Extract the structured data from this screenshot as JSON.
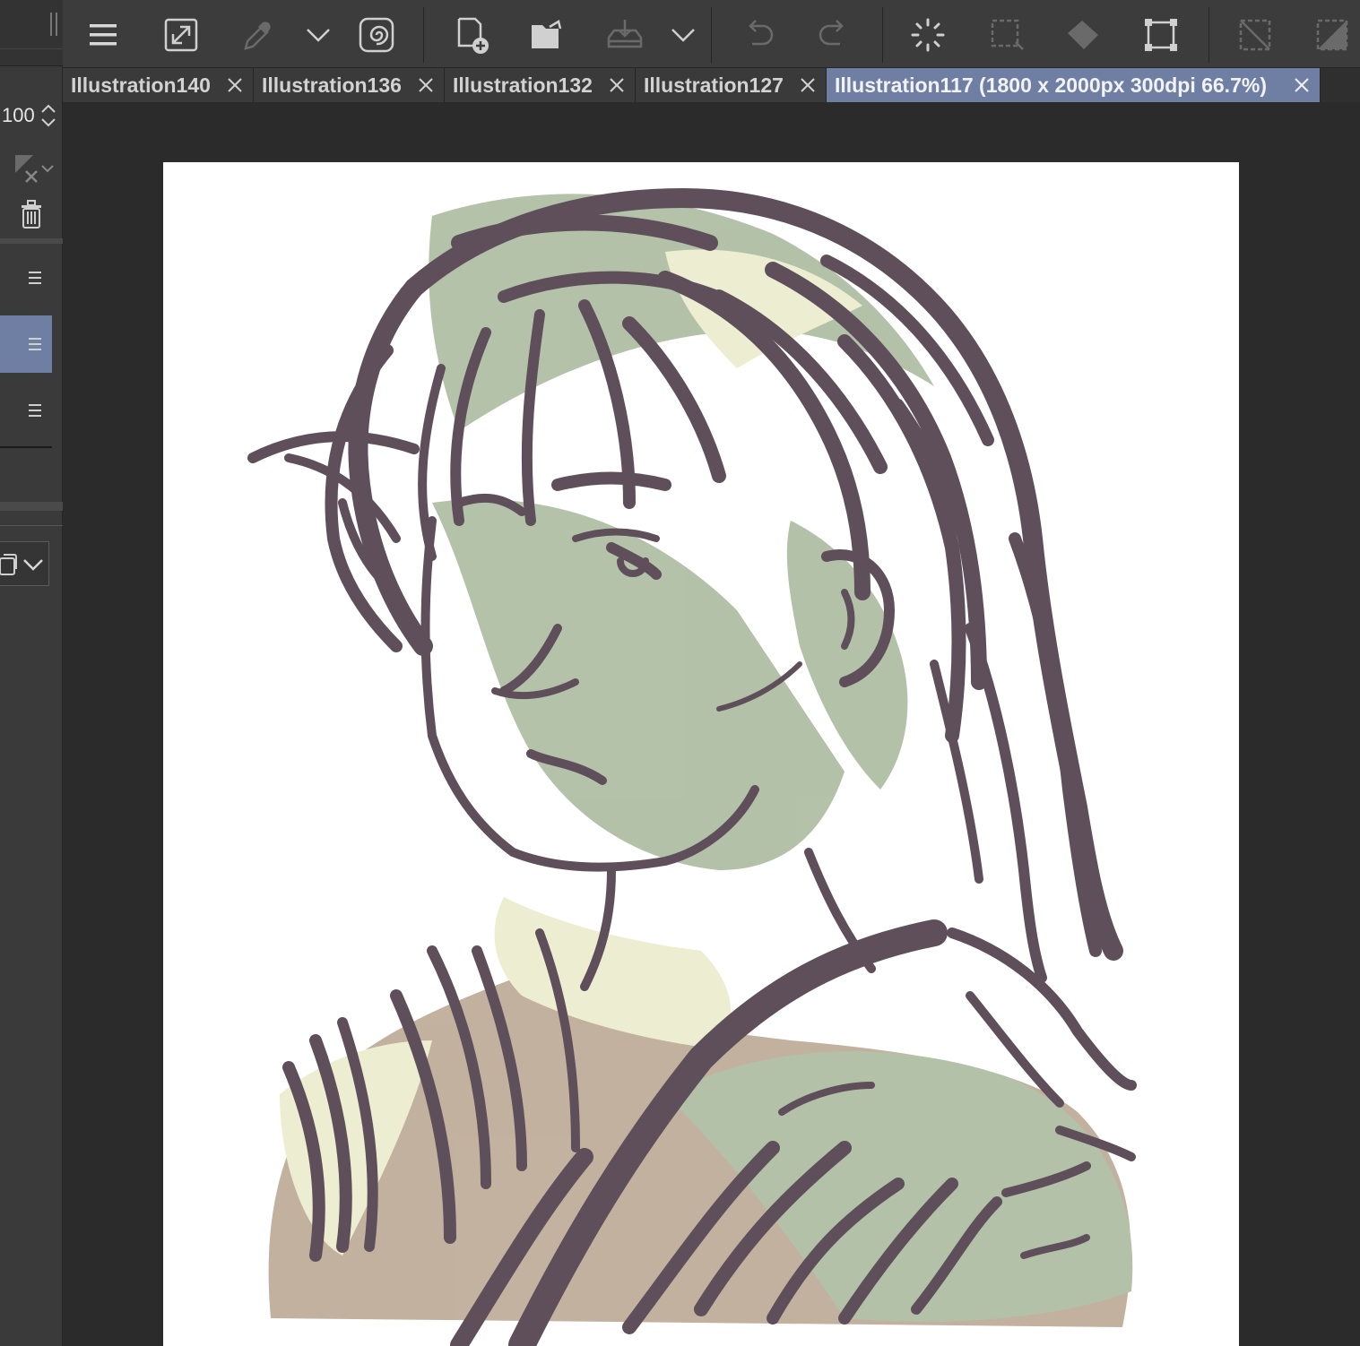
{
  "layer_panel": {
    "opacity_value": "100"
  },
  "toolbar": {
    "icons": [
      "menu-icon",
      "resize-canvas-icon",
      "eyedropper-icon",
      "chevron-down-icon",
      "spiral-icon",
      "new-file-icon",
      "open-folder-icon",
      "download-tray-icon",
      "chevron-down-icon",
      "undo-icon",
      "redo-icon",
      "loading-icon",
      "selection-icon",
      "fill-bucket-icon",
      "transform-icon",
      "deselect-icon",
      "shape-icon"
    ]
  },
  "tabs": [
    {
      "label": "Illustration140",
      "active": false
    },
    {
      "label": "Illustration136",
      "active": false
    },
    {
      "label": "Illustration132",
      "active": false
    },
    {
      "label": "Illustration127",
      "active": false
    },
    {
      "label": "Illustration117 (1800 x 2000px 300dpi 66.7%)",
      "active": true
    }
  ],
  "colors": {
    "accent": "#6f7fa4",
    "ink": "#5e4f5a",
    "shade_green": "#a6b79a",
    "shade_cream": "#e9ebc9",
    "shade_tan": "#b8a48f"
  }
}
